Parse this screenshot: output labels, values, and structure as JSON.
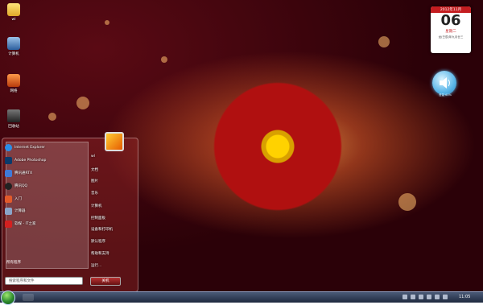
{
  "desktop": {
    "icons": [
      {
        "label": "wl",
        "name": "user-folder-icon"
      },
      {
        "label": "计算机",
        "name": "computer-icon"
      },
      {
        "label": "网络",
        "name": "network-icon"
      },
      {
        "label": "回收站",
        "name": "recycle-bin-icon"
      }
    ]
  },
  "calendar": {
    "year_month": "2012年11月",
    "day": "06",
    "weekday": "星期二",
    "lunar": "龙(壬辰)年九月廿三"
  },
  "volume_gadget": {
    "label": "音量 60%"
  },
  "start_menu": {
    "pinned": [
      {
        "label": "Internet Explorer",
        "icon": "internet-explorer-icon"
      },
      {
        "label": "Adobe Photoshop",
        "icon": "photoshop-icon"
      },
      {
        "label": "腾讯通RTX",
        "icon": "rtx-icon"
      },
      {
        "label": "腾讯QQ",
        "icon": "qq-icon"
      },
      {
        "label": "入门",
        "icon": "getting-started-icon"
      },
      {
        "label": "计算器",
        "icon": "calculator-icon"
      },
      {
        "label": "软媒 - IT之家",
        "icon": "ithome-icon"
      }
    ],
    "all_programs": "所有程序",
    "search_placeholder": "搜索程序和文件",
    "right": [
      "wl",
      "文档",
      "图片",
      "音乐",
      "计算机",
      "控制面板",
      "设备和打印机",
      "默认程序",
      "帮助和支持",
      "运行..."
    ],
    "shutdown": "关机"
  },
  "taskbar": {
    "clock": "11:05"
  }
}
